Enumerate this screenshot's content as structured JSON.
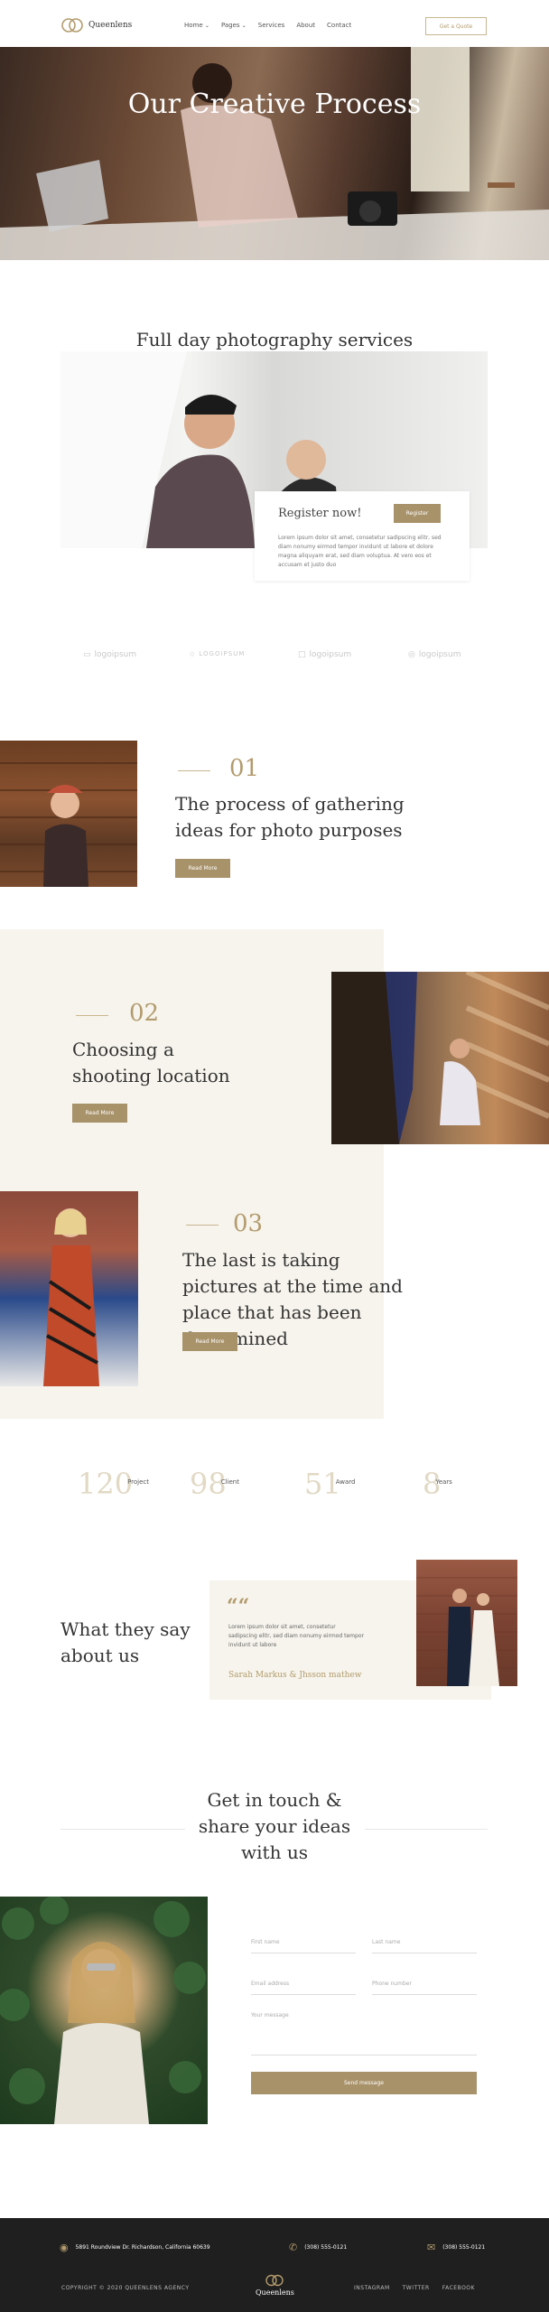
{
  "header": {
    "brand": "Queenlens",
    "nav": [
      {
        "label": "Home",
        "has_dropdown": true
      },
      {
        "label": "Pages",
        "has_dropdown": true
      },
      {
        "label": "Services",
        "has_dropdown": false
      },
      {
        "label": "About",
        "has_dropdown": false
      },
      {
        "label": "Contact",
        "has_dropdown": false
      }
    ],
    "dropdown_icon": "chevron-down-icon",
    "quote_button": "Get a Quote"
  },
  "hero": {
    "title": "Our Creative Process"
  },
  "intro": {
    "title": "Full day photography services with our photographer",
    "register": {
      "title": "Register now!",
      "button": "Register",
      "text": "Lorem ipsum dolor sit amet, consetetur sadipscing elitr, sed diam nonumy eirmod tempor invidunt ut labore et dolore magna aliquyam erat, sed diam voluptua. At vero eos et accusam et justo duo"
    }
  },
  "brands": [
    "logoipsum",
    "LOGOIPSUM",
    "logoipsum",
    "logoipsum"
  ],
  "steps": [
    {
      "number": "01",
      "title": "The process of gathering ideas for photo purposes",
      "button": "Read More"
    },
    {
      "number": "02",
      "title": "Choosing a shooting location",
      "button": "Read More"
    },
    {
      "number": "03",
      "title": "The last is taking pictures at the time and place that has been determined",
      "button": "Read More"
    }
  ],
  "stats": [
    {
      "number": "120",
      "label": "Project"
    },
    {
      "number": "98",
      "label": "Client"
    },
    {
      "number": "51",
      "label": "Award"
    },
    {
      "number": "8",
      "label": "Years"
    }
  ],
  "testimonial": {
    "title": "What they say about us",
    "quote_mark": "““",
    "text": "Lorem ipsum dolor sit amet, consetetur sadipscing elitr, sed diam nonumy eirmod tempor invidunt ut labore",
    "author": "Sarah Markus & Jhsson mathew"
  },
  "contact": {
    "title": "Get in touch & share your ideas with us",
    "first_name": "First name",
    "last_name": "Last name",
    "email": "Email address",
    "phone": "Phone number",
    "message": "Your message",
    "send": "Send message"
  },
  "footer": {
    "address": "5891 Roundview Dr. Richardson, California 60639",
    "phone": "(308) 555-0121",
    "email": "(308) 555-0121",
    "copyright": "COPYRIGHT © 2020 QUEENLENS AGENCY",
    "brand": "Queenlens",
    "links": [
      "INSTAGRAM",
      "TWITTER",
      "FACEBOOK"
    ]
  },
  "colors": {
    "accent": "#a8926a",
    "beige": "#f6f4ec",
    "footer": "#1f1f1f"
  }
}
